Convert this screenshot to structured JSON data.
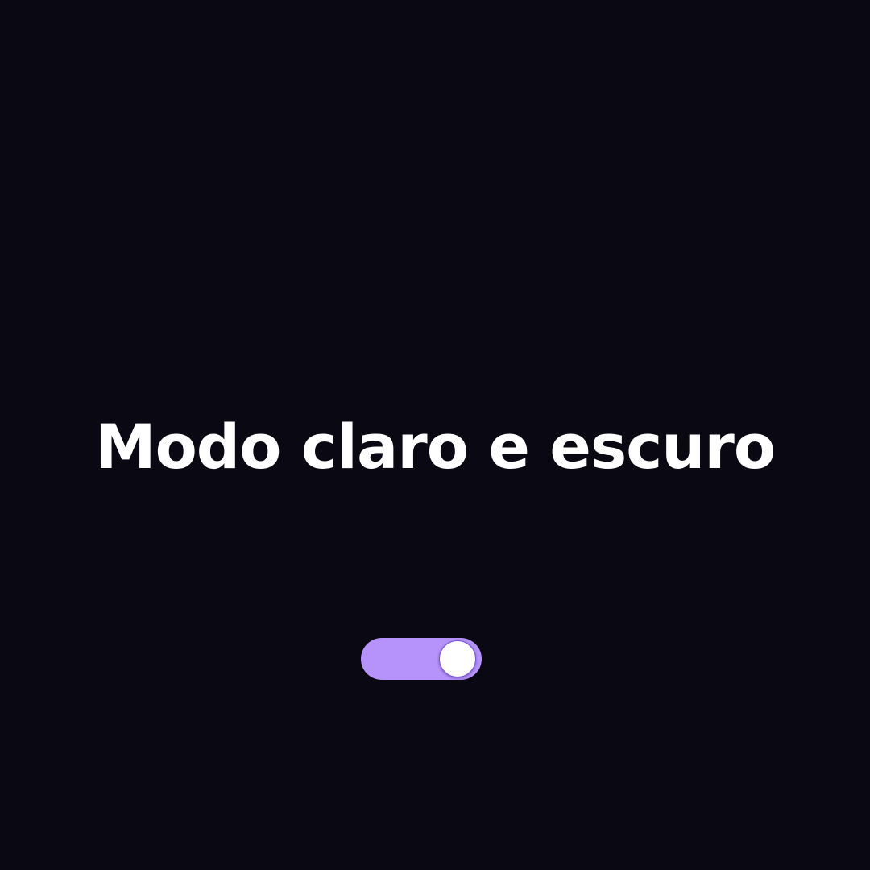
{
  "page": {
    "title": "Modo claro e escuro"
  },
  "theme_toggle": {
    "state": "on",
    "track_color": "#b692fb",
    "knob_color": "#ffffff"
  },
  "colors": {
    "background": "#0a0913",
    "text": "#ffffff"
  }
}
